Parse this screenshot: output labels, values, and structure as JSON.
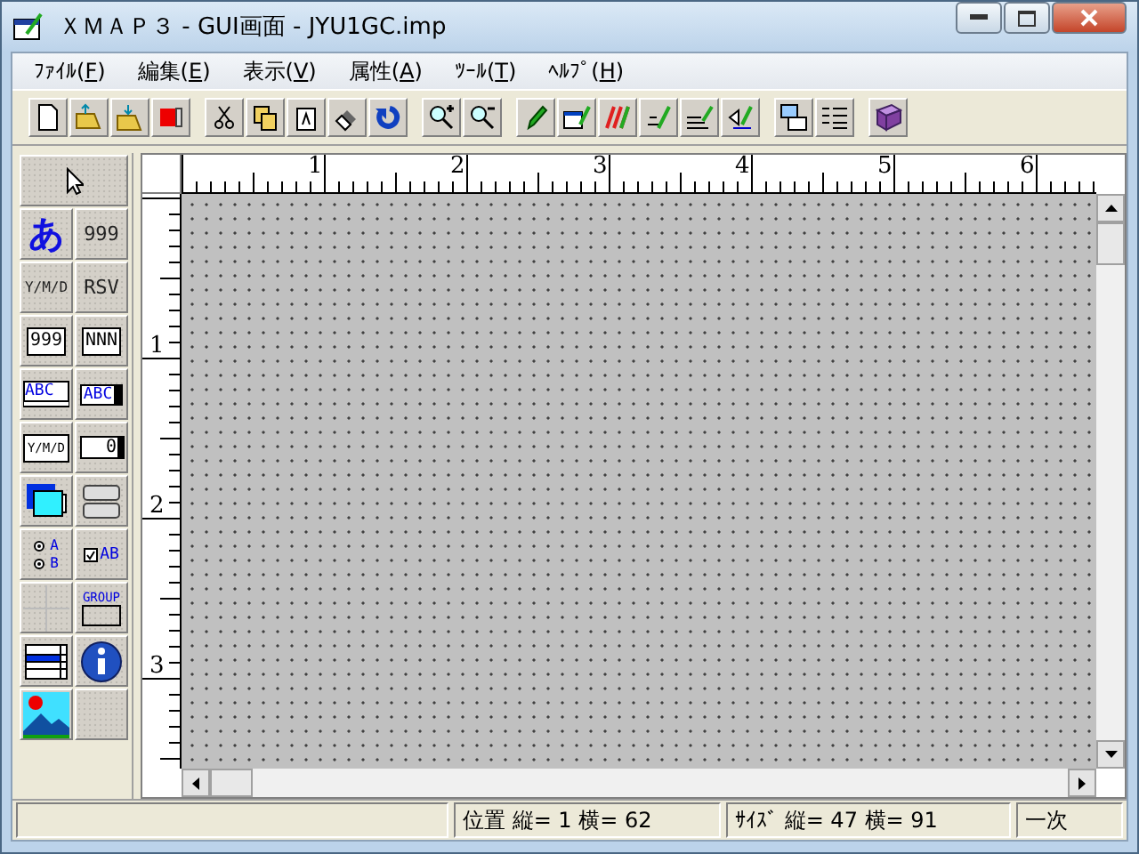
{
  "window": {
    "title": "ＸＭＡＰ３ - GUI画面 - JYU1GC.imp"
  },
  "menu": [
    {
      "before": "ﾌｧｲﾙ(",
      "key": "F",
      "after": ")"
    },
    {
      "before": "編集(",
      "key": "E",
      "after": ")"
    },
    {
      "before": "表示(",
      "key": "V",
      "after": ")"
    },
    {
      "before": "属性(",
      "key": "A",
      "after": ")"
    },
    {
      "before": "ﾂｰﾙ(",
      "key": "T",
      "after": ")"
    },
    {
      "before": "ﾍﾙﾌﾟ(",
      "key": "H",
      "after": ")"
    }
  ],
  "palette": [
    {
      "kind": "pointer"
    },
    {
      "kind": "glyph",
      "text": "あ"
    },
    {
      "kind": "plain",
      "text": "999"
    },
    {
      "kind": "small",
      "text": "Y/M/D"
    },
    {
      "kind": "plain",
      "text": "RSV"
    },
    {
      "kind": "framed",
      "text": "999"
    },
    {
      "kind": "framed",
      "text": "NNN"
    },
    {
      "kind": "listbox",
      "text": "ABC"
    },
    {
      "kind": "combo",
      "text": "ABC"
    },
    {
      "kind": "framed",
      "text": "Y/M/D"
    },
    {
      "kind": "spin",
      "text": "0"
    },
    {
      "kind": "window"
    },
    {
      "kind": "buttons"
    },
    {
      "kind": "radio",
      "texts": [
        "A",
        "B"
      ]
    },
    {
      "kind": "check",
      "text": "AB"
    },
    {
      "kind": "cross"
    },
    {
      "kind": "group",
      "text": "GROUP"
    },
    {
      "kind": "grid"
    },
    {
      "kind": "info"
    },
    {
      "kind": "picture"
    },
    {
      "kind": "empty"
    }
  ],
  "ruler": {
    "horizontal": [
      "1",
      "2",
      "3",
      "4",
      "5",
      "6"
    ],
    "vertical": [
      "1",
      "2",
      "3"
    ]
  },
  "status_bar": [
    "位置 縦= 1 横= 62",
    "ｻｲｽﾞ 縦= 47 横= 91",
    "一次"
  ]
}
